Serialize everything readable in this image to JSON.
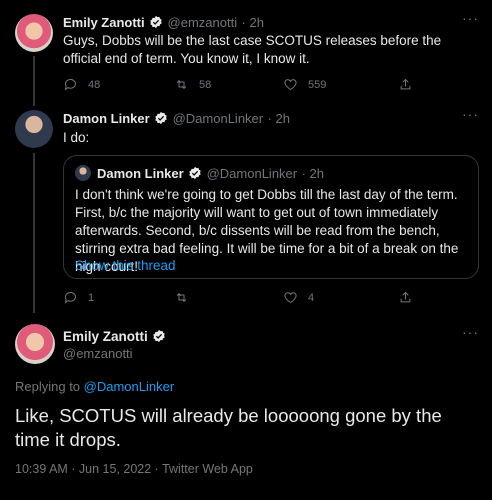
{
  "tweet1": {
    "name": "Emily Zanotti",
    "handle": "@emzanotti",
    "time": "· 2h",
    "text": "Guys, Dobbs will be the last case SCOTUS releases before the official end of term. You know it, I know it.",
    "replies": "48",
    "retweets": "58",
    "likes": "559"
  },
  "tweet2": {
    "name": "Damon Linker",
    "handle": "@DamonLinker",
    "time": "· 2h",
    "text": "I do:",
    "replies": "1",
    "retweets": "",
    "likes": "4",
    "quote": {
      "name": "Damon Linker",
      "handle": "@DamonLinker",
      "time": "· 2h",
      "text": "I don't think we're going to get Dobbs till the last day of the term. First, b/c the majority will want to get out of town immediately afterwards. Second, b/c dissents will be read from the bench, stirring extra bad feeling. It will be time for a bit of a break on the high court!",
      "show_thread": "Show this thread"
    }
  },
  "main_tweet": {
    "name": "Emily Zanotti",
    "handle": "@emzanotti",
    "replying_prefix": "Replying to ",
    "replying_to": "@DamonLinker",
    "text": "Like, SCOTUS will already be looooong gone by the time it drops.",
    "timestamp": "10:39 AM · Jun 15, 2022 · Twitter Web App"
  },
  "colors": {
    "background": "#000000",
    "text": "#e7e9ea",
    "muted": "#71767b",
    "accent": "#1d9bf0",
    "border": "#333639"
  },
  "icons": [
    "more-icon",
    "verified-icon",
    "reply-icon",
    "retweet-icon",
    "like-icon",
    "share-icon"
  ]
}
